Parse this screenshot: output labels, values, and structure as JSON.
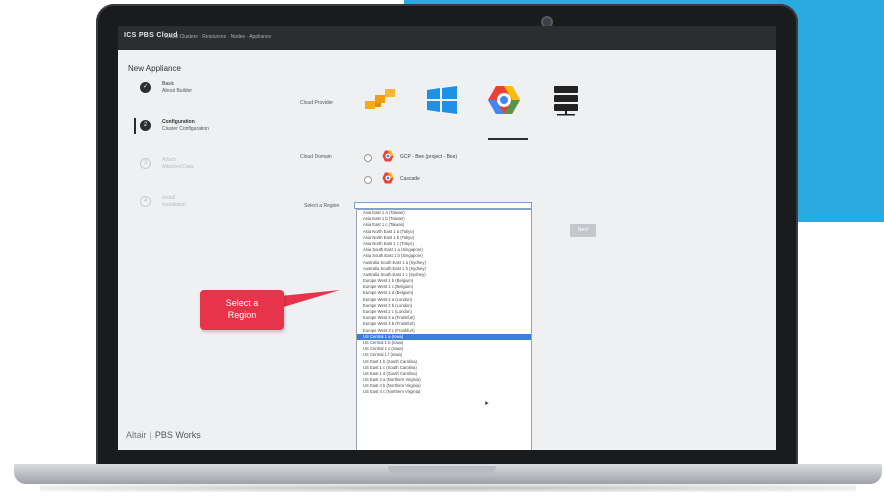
{
  "app": {
    "brand": "ICS PBS Cloud",
    "breadcrumb": "Virtual Clusters · Resources · Nodes · Appliance",
    "page_title": "New Appliance"
  },
  "steps": [
    {
      "num": "✓",
      "title": "Basic",
      "subtitle": "About Builder",
      "state": "done"
    },
    {
      "num": "2",
      "title": "Configuration",
      "subtitle": "Cluster Configuration",
      "state": "active"
    },
    {
      "num": "3",
      "title": "Attach",
      "subtitle": "Attached Data",
      "state": "idle"
    },
    {
      "num": "4",
      "title": "Install",
      "subtitle": "Installation",
      "state": "idle"
    }
  ],
  "form": {
    "cloud_provider_label": "Cloud Provider",
    "cloud_domain_label": "Cloud Domain",
    "select_region_label": "Select a Region",
    "domains": [
      "GCP - Bee (project - Bee)",
      "Cascade"
    ],
    "region_value": "",
    "next_label": "Next"
  },
  "providers": [
    "aws-icon",
    "windows-azure-icon",
    "google-cloud-icon",
    "server-stack-icon"
  ],
  "regions": [
    "Asia East 1 a (Taiwan)",
    "Asia East 1 b (Taiwan)",
    "Asia East 1 c (Taiwan)",
    "Asia North East 1 a (Tokyo)",
    "Asia North East 1 b (Tokyo)",
    "Asia North East 1 c (Tokyo)",
    "Asia South East 1 a (Singapore)",
    "Asia South East 1 b (Singapore)",
    "Australia South East 1 a (Sydney)",
    "Australia South East 1 b (Sydney)",
    "Australia South East 1 c (Sydney)",
    "Europe West 1 b (Belgium)",
    "Europe West 1 c (Belgium)",
    "Europe West 1 d (Belgium)",
    "Europe West 2 a (London)",
    "Europe West 2 b (London)",
    "Europe West 2 c (London)",
    "Europe West 3 a (Frankfurt)",
    "Europe West 3 b (Frankfurt)",
    "Europe West 3 c (Frankfurt)",
    "US Central 1 a (Iowa)",
    "US Central 1 b (Iowa)",
    "US Central 1 c (Iowa)",
    "US Central 1 f (Iowa)",
    "US East 1 b (South Carolina)",
    "US East 1 c (South Carolina)",
    "US East 1 d (South Carolina)",
    "US East 4 a (Northern Virginia)",
    "US East 4 b (Northern Virginia)",
    "US East 4 c (Northern Virginia)"
  ],
  "selected_region_index": 20,
  "callout": {
    "line1": "Select a",
    "line2": "Region"
  },
  "footer": {
    "brand1": "Altair",
    "brand2": "PBS Works"
  },
  "colors": {
    "accent_blue": "#29abe2",
    "callout_red": "#e8344a",
    "selection_blue": "#3a7ee0"
  }
}
